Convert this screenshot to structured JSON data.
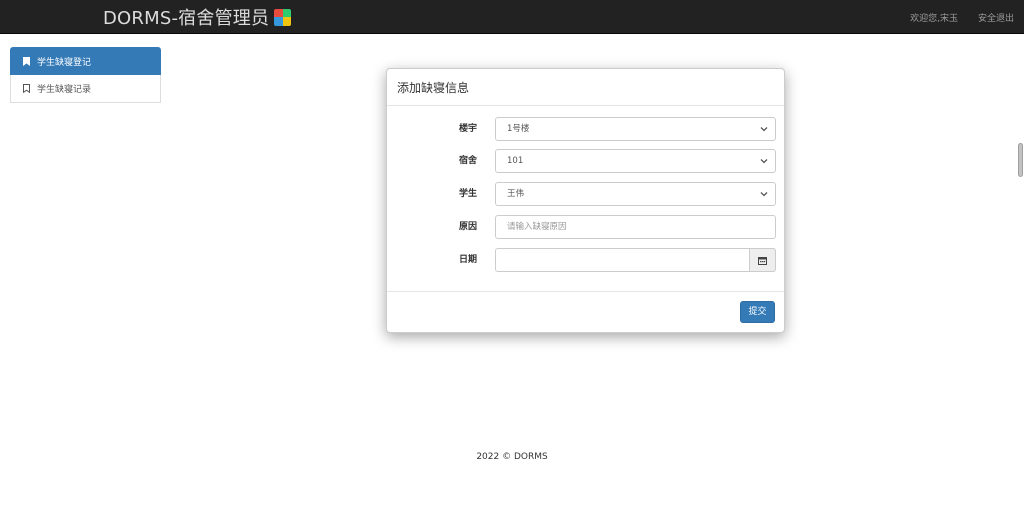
{
  "navbar": {
    "brand": "DORMS-宿舍管理员",
    "welcome": "欢迎您,宋玉",
    "logout": "安全退出"
  },
  "sidebar": {
    "items": [
      {
        "label": "学生缺寝登记",
        "active": true
      },
      {
        "label": "学生缺寝记录",
        "active": false
      }
    ]
  },
  "modal": {
    "title": "添加缺寝信息",
    "fields": {
      "building": {
        "label": "楼宇",
        "value": "1号楼"
      },
      "dorm": {
        "label": "宿舍",
        "value": "101"
      },
      "student": {
        "label": "学生",
        "value": "王伟"
      },
      "reason": {
        "label": "原因",
        "placeholder": "请输入缺寝原因"
      },
      "date": {
        "label": "日期",
        "value": ""
      }
    },
    "submit_label": "提交"
  },
  "footer": {
    "text": "2022 © DORMS"
  },
  "colors": {
    "navbar_bg": "#222222",
    "primary": "#337ab7"
  }
}
